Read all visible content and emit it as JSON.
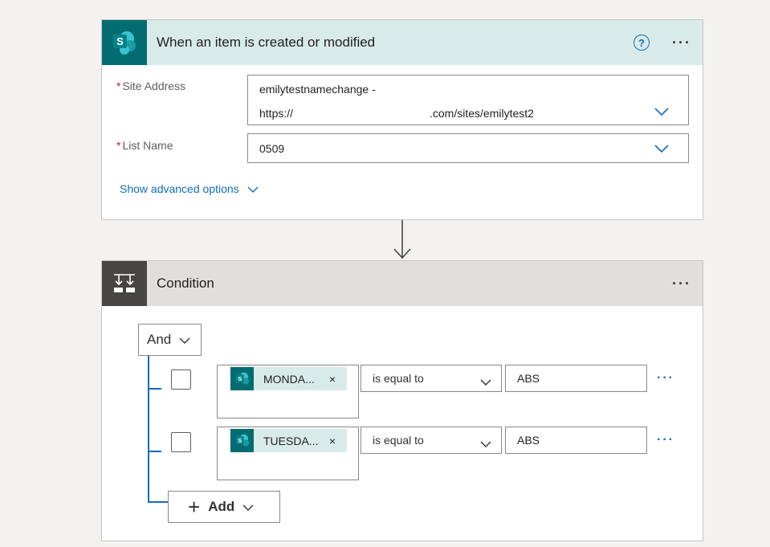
{
  "trigger": {
    "title": "When an item is created or modified",
    "help_symbol": "?",
    "more_symbol": "···",
    "site_address": {
      "label": "Site Address",
      "required_mark": "*",
      "value_line1": "emilytestnamechange -",
      "value_line2_prefix": "https://",
      "value_line2_suffix": ".com/sites/emilytest2"
    },
    "list_name": {
      "label": "List Name",
      "required_mark": "*",
      "value": "0509"
    },
    "advanced_link": "Show advanced options"
  },
  "condition": {
    "title": "Condition",
    "more_symbol": "···",
    "group_operator": "And",
    "rows": [
      {
        "token": "MONDA...",
        "token_remove": "×",
        "operator": "is equal to",
        "value": "ABS",
        "more": "···"
      },
      {
        "token": "TUESDA...",
        "token_remove": "×",
        "operator": "is equal to",
        "value": "ABS",
        "more": "···"
      }
    ],
    "add_label": "Add",
    "add_symbol": "+"
  },
  "icons": {
    "trigger_icon": "sharepoint-icon",
    "condition_icon": "condition-icon",
    "connector_arrow": "down-arrow-icon"
  },
  "colors": {
    "sharepoint": "#036c70",
    "trigger_header": "#d9ebe9",
    "condition_header": "#e1dfdd",
    "accent": "#0f6cbd"
  }
}
